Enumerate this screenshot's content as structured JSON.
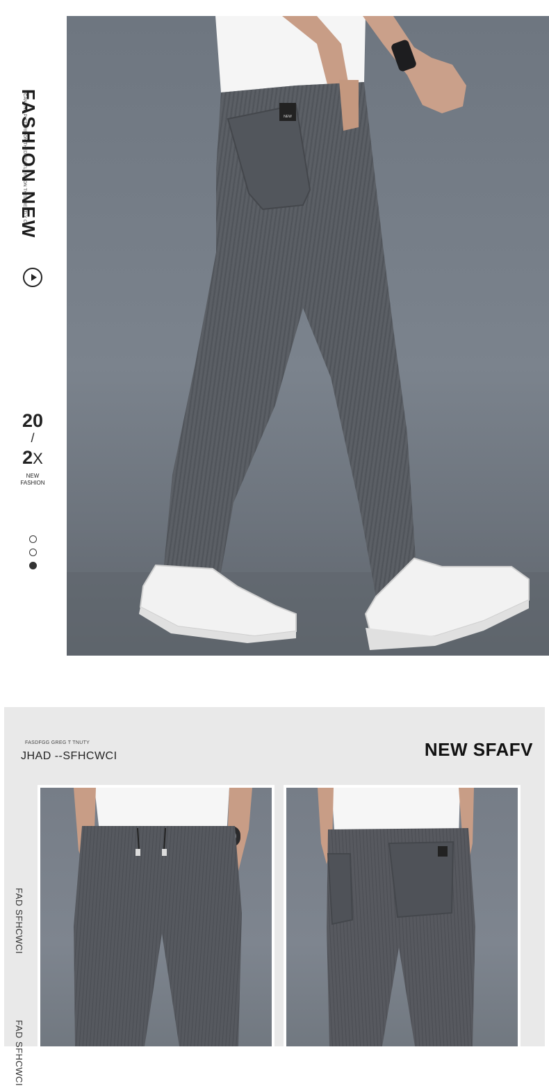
{
  "hero": {
    "vertical_title": "FASHION NEW",
    "vertical_subtitle": "SCAN THE PICTURE ON THEDIRECTLURE ON THEDIRECTLY CLI",
    "year_top": "20",
    "year_slash": "/",
    "year_bottom": "2",
    "year_suffix": "X",
    "badge_line1": "NEW",
    "badge_line2": "FASHION",
    "carousel_dots": 3,
    "active_dot": 3,
    "pocket_label": "NEW"
  },
  "details": {
    "small_caption": "FASDFGG GREG T TNUTY",
    "code": "JHAD --SFHCWCI",
    "title": "NEW SFAFV",
    "side_label_1": "FAD SFHCWCI",
    "side_label_2": "FAD SFHCWCI"
  },
  "colors": {
    "photo_bg": "#767d87",
    "fabric": "#565a60",
    "shirt": "#f6f6f6",
    "skin": "#caa08a",
    "section_bg": "#e9e9e9"
  }
}
